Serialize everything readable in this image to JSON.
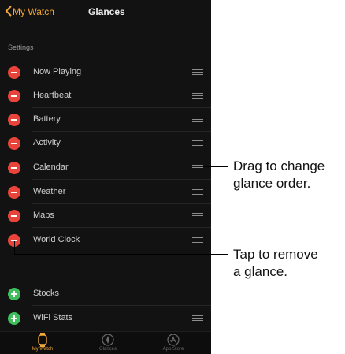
{
  "navbar": {
    "back_label": "My Watch",
    "title": "Glances"
  },
  "settings_header": "Settings",
  "glances": [
    {
      "label": "Now Playing"
    },
    {
      "label": "Heartbeat"
    },
    {
      "label": "Battery"
    },
    {
      "label": "Activity"
    },
    {
      "label": "Calendar"
    },
    {
      "label": "Weather"
    },
    {
      "label": "Maps"
    },
    {
      "label": "World Clock"
    }
  ],
  "do_not_include": [
    {
      "label": "Stocks"
    },
    {
      "label": "WiFi Stats"
    }
  ],
  "tabbar": [
    {
      "label": "My Watch",
      "icon": "watch-icon"
    },
    {
      "label": "Glances",
      "icon": "compass-icon"
    },
    {
      "label": "App Store",
      "icon": "app-store-icon"
    }
  ],
  "callouts": {
    "drag": {
      "line1": "Drag to change",
      "line2": "glance order."
    },
    "tap": {
      "line1": "Tap to remove",
      "line2": "a glance."
    }
  },
  "colors": {
    "accent": "#f2a73b",
    "remove": "#e8443a",
    "add": "#3fbf5c",
    "background": "#121212"
  }
}
